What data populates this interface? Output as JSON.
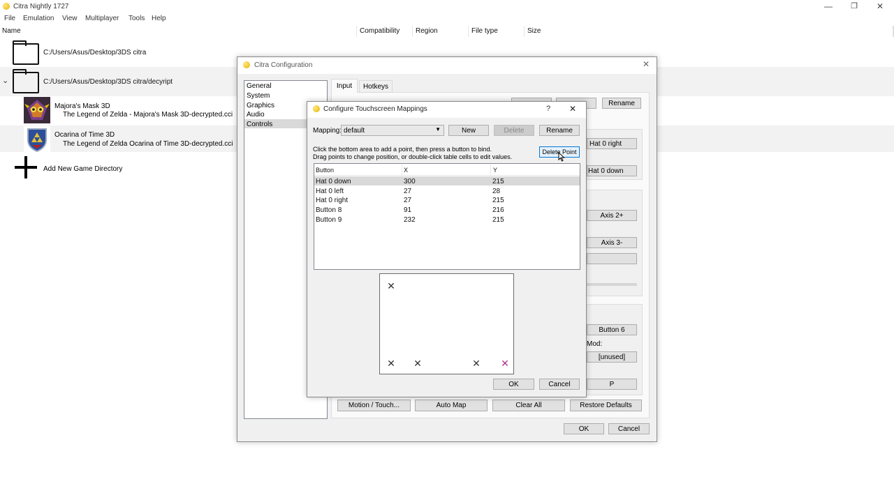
{
  "window": {
    "title": "Citra Nightly 1727",
    "min": "—",
    "restore": "❐",
    "close": "✕"
  },
  "menu": [
    "File",
    "Emulation",
    "View",
    "Multiplayer",
    "Tools",
    "Help"
  ],
  "gamelist": {
    "columns": {
      "name": "Name",
      "compat": "Compatibility",
      "region": "Region",
      "filetype": "File type",
      "size": "Size"
    },
    "dir1": "C:/Users/Asus/Desktop/3DS citra",
    "dir2": "C:/Users/Asus/Desktop/3DS citra/decyript",
    "games": [
      {
        "title": "Majora's Mask 3D",
        "file": "The Legend of Zelda - Majora's Mask 3D-decrypted.cci"
      },
      {
        "title": "Ocarina of Time 3D",
        "file": "The Legend of Zelda Ocarina of Time 3D-decrypted.cci"
      }
    ],
    "add_dir": "Add New Game Directory"
  },
  "config": {
    "title": "Citra Configuration",
    "close": "✕",
    "sidebar": [
      "General",
      "System",
      "Graphics",
      "Audio",
      "Controls"
    ],
    "tabs": [
      "Input",
      "Hotkeys"
    ],
    "rename": "Rename",
    "right_buttons": [
      "Hat 0 right",
      "Hat 0 down",
      "Axis 2+",
      "Axis 3-",
      "Button 6",
      "[unused]",
      "P"
    ],
    "mod_label": "Mod:",
    "bottom": [
      "Motion / Touch...",
      "Auto Map",
      "Clear All",
      "Restore Defaults"
    ],
    "ok": "OK",
    "cancel": "Cancel"
  },
  "touch": {
    "title": "Configure Touchscreen Mappings",
    "help": "?",
    "close": "✕",
    "mapping_label": "Mapping:",
    "mapping_value": "default",
    "new": "New",
    "delete": "Delete",
    "rename": "Rename",
    "instruction1": "Click the bottom area to add a point, then press a button to bind.",
    "instruction2": "Drag points to change position, or double-click table cells to edit values.",
    "delete_point": "Delete Point",
    "headers": [
      "Button",
      "X",
      "Y"
    ],
    "rows": [
      [
        "Hat 0 down",
        "300",
        "215"
      ],
      [
        "Hat 0 left",
        "27",
        "28"
      ],
      [
        "Hat 0 right",
        "27",
        "215"
      ],
      [
        "Button 8",
        "91",
        "216"
      ],
      [
        "Button 9",
        "232",
        "215"
      ]
    ],
    "mark": "✕",
    "ok": "OK",
    "cancel": "Cancel"
  },
  "colors": {
    "accent": "#0078d7",
    "selected_row": "#d9d9d9",
    "highlight_mark": "#b0308f"
  }
}
